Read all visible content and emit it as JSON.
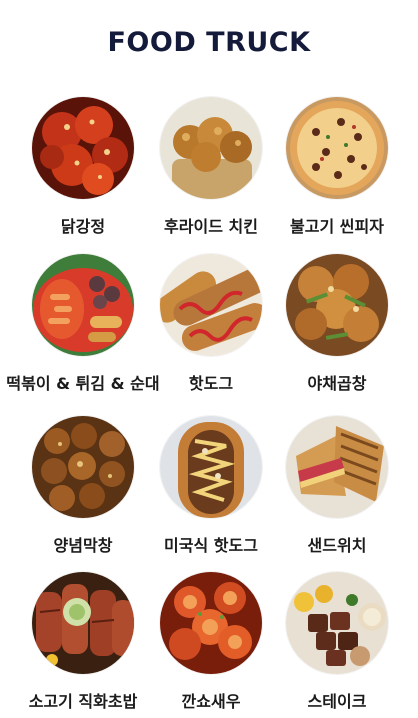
{
  "header": {
    "title": "FOOD TRUCK"
  },
  "menu": [
    {
      "label": "닭강정",
      "image": "sweet-crispy-chicken"
    },
    {
      "label": "후라이드 치킨",
      "image": "fried-chicken"
    },
    {
      "label": "불고기 씬피자",
      "image": "bulgogi-thin-pizza"
    },
    {
      "label": "떡볶이 & 튀김 & 순대",
      "image": "tteokbokki-tempura-sundae"
    },
    {
      "label": "핫도그",
      "image": "hotdog"
    },
    {
      "label": "야채곱창",
      "image": "vegetable-gopchang"
    },
    {
      "label": "양념막창",
      "image": "seasoned-makchang"
    },
    {
      "label": "미국식 핫도그",
      "image": "american-hotdog"
    },
    {
      "label": "샌드위치",
      "image": "sandwich"
    },
    {
      "label": "소고기 직화초밥",
      "image": "flame-grilled-beef-sushi"
    },
    {
      "label": "깐쇼새우",
      "image": "chili-shrimp"
    },
    {
      "label": "스테이크",
      "image": "steak"
    }
  ]
}
